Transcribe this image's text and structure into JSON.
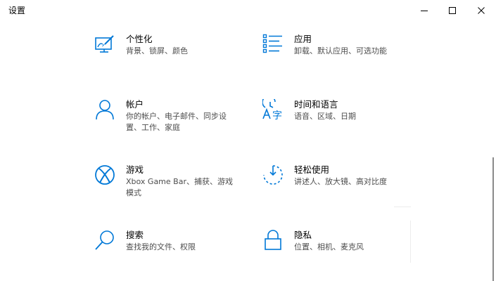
{
  "window": {
    "title": "设置"
  },
  "tiles": [
    {
      "name": "个性化",
      "desc": "背景、锁屏、颜色",
      "icon": "personalization-icon"
    },
    {
      "name": "应用",
      "desc": "卸载、默认应用、可选功能",
      "icon": "apps-icon"
    },
    {
      "name": "帐户",
      "desc": "你的帐户、电子邮件、同步设置、工作、家庭",
      "icon": "account-icon"
    },
    {
      "name": "时间和语言",
      "desc": "语音、区域、日期",
      "icon": "time-language-icon"
    },
    {
      "name": "游戏",
      "desc": "Xbox Game Bar、捕获、游戏模式",
      "icon": "xbox-icon"
    },
    {
      "name": "轻松使用",
      "desc": "讲述人、放大镜、高对比度",
      "icon": "ease-of-access-icon"
    },
    {
      "name": "搜索",
      "desc": "查找我的文件、权限",
      "icon": "search-icon"
    },
    {
      "name": "隐私",
      "desc": "位置、相机、麦克风",
      "icon": "lock-icon"
    }
  ],
  "colors": {
    "accent": "#0078d7",
    "text": "#000000",
    "subtext": "#4d4d4d"
  }
}
